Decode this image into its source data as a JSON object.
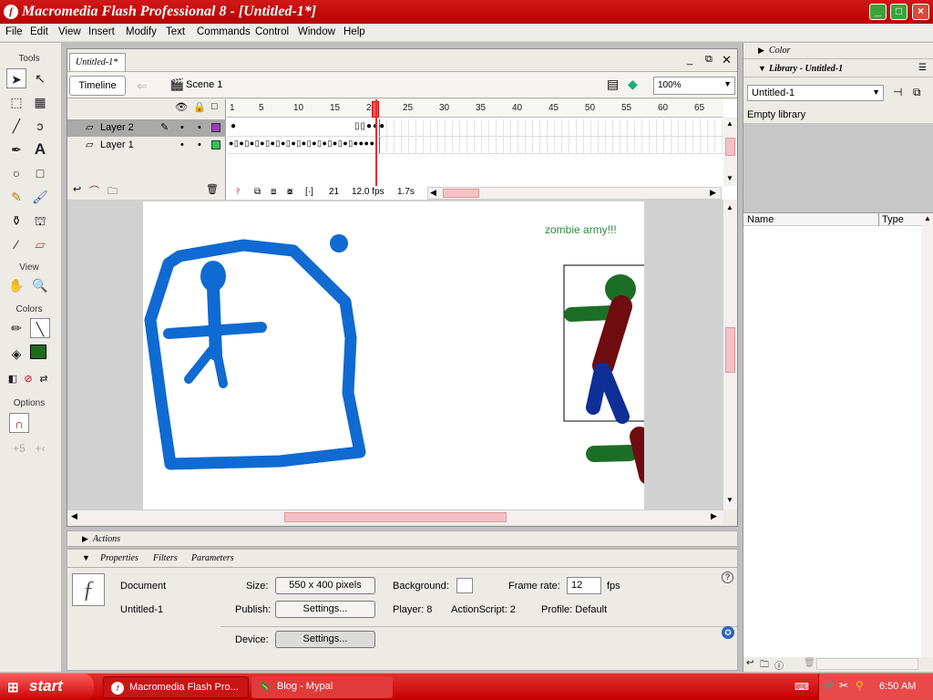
{
  "window": {
    "title": "Macromedia Flash Professional 8 - [Untitled-1*]",
    "app_icon": "f"
  },
  "menubar": [
    "File",
    "Edit",
    "View",
    "Insert",
    "Modify",
    "Text",
    "Commands",
    "Control",
    "Window",
    "Help"
  ],
  "tools": {
    "title": "Tools",
    "view_label": "View",
    "colors_label": "Colors",
    "options_label": "Options",
    "stroke_color": "#000000",
    "fill_color": "#1e6b1e",
    "icons": [
      "arrow-tool-icon",
      "subselection-tool-icon",
      "free-transform-icon",
      "gradient-transform-icon",
      "line-tool-icon",
      "lasso-tool-icon",
      "pen-tool-icon",
      "text-tool-icon",
      "oval-tool-icon",
      "rectangle-tool-icon",
      "pencil-tool-icon",
      "brush-tool-icon",
      "ink-bottle-icon",
      "paint-bucket-icon",
      "eyedropper-icon",
      "eraser-icon",
      "hand-tool-icon",
      "zoom-tool-icon"
    ]
  },
  "document": {
    "tab": "Untitled-1*",
    "timeline_button": "Timeline",
    "scene": "Scene 1",
    "zoom": "100%"
  },
  "timeline": {
    "layers": [
      {
        "name": "Layer 2",
        "color": "#9b3bbd",
        "selected": true
      },
      {
        "name": "Layer 1",
        "color": "#2ec84a",
        "selected": false
      }
    ],
    "ruler": [
      "1",
      "5",
      "10",
      "15",
      "20",
      "25",
      "30",
      "35",
      "40",
      "45",
      "50",
      "55",
      "60",
      "65"
    ],
    "current_frame": "21",
    "fps": "12.0 fps",
    "time": "1.7s"
  },
  "stage": {
    "text": "zombie army!!!",
    "colors": {
      "blue": "#0f6ad2",
      "green": "#1c6e26",
      "maroon": "#6e0c10",
      "navy": "#0d2f96",
      "text_green": "#2f8a3a"
    }
  },
  "actions_panel": {
    "label": "Actions"
  },
  "properties": {
    "tabs": [
      "Properties",
      "Filters",
      "Parameters"
    ],
    "type_label": "Document",
    "doc_name": "Untitled-1",
    "size_label": "Size:",
    "size_value": "550 x 400 pixels",
    "background_label": "Background:",
    "frame_rate_label": "Frame rate:",
    "frame_rate_value": "12",
    "fps_unit": "fps",
    "publish_label": "Publish:",
    "settings_label": "Settings...",
    "player": "Player: 8",
    "actionscript": "ActionScript:  2",
    "profile": "Profile:  Default",
    "device_label": "Device:"
  },
  "right_panel": {
    "color_label": "Color",
    "library_label": "Library - Untitled-1",
    "library_select": "Untitled-1",
    "empty_text": "Empty library",
    "col_name": "Name",
    "col_type": "Type"
  },
  "taskbar": {
    "start": "start",
    "items": [
      "Macromedia Flash Pro...",
      "Blog - Mypal"
    ],
    "clock": "6:50 AM"
  }
}
